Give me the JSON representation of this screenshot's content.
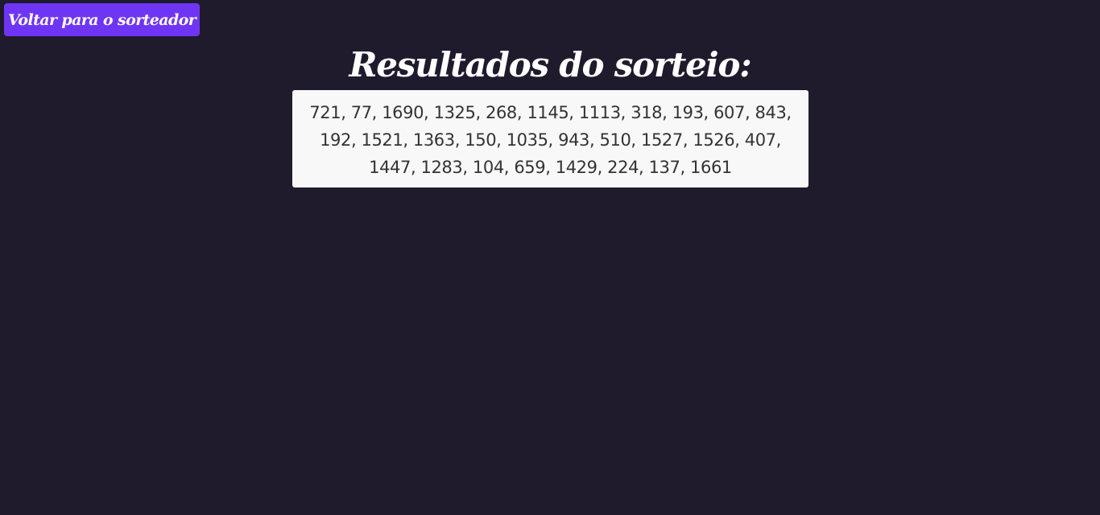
{
  "nav": {
    "back_label": "Voltar para o sorteador"
  },
  "main": {
    "title": "Resultados do sorteio:",
    "results": "721, 77, 1690, 1325, 268, 1145, 1113, 318, 193, 607, 843, 192, 1521, 1363, 150, 1035, 943, 510, 1527, 1526, 407, 1447, 1283, 104, 659, 1429, 224, 137, 1661"
  },
  "colors": {
    "background": "#1f1b2d",
    "accent": "#6f35f5",
    "results_box": "#f8f8f8",
    "results_text": "#333333"
  }
}
